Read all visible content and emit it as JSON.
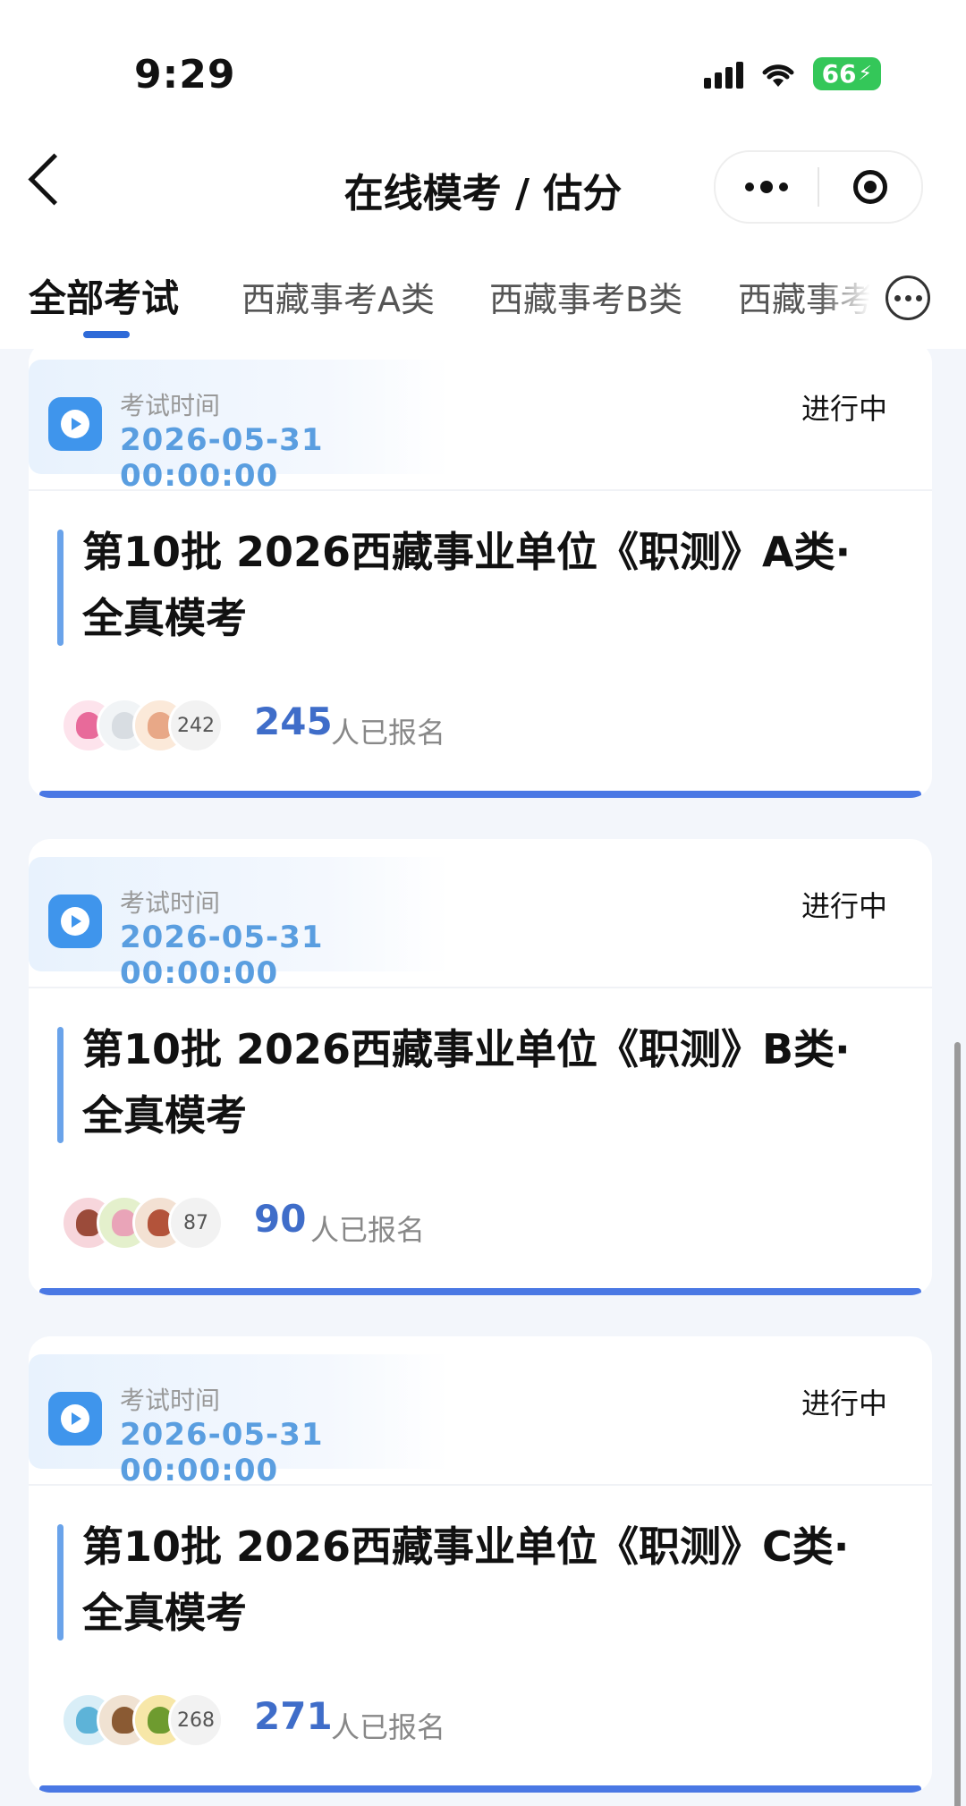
{
  "status_bar": {
    "time": "9:29",
    "battery": "66"
  },
  "nav": {
    "title": "在线模考 / 估分"
  },
  "tabs": [
    {
      "label": "全部考试",
      "active": true
    },
    {
      "label": "西藏事考A类",
      "active": false
    },
    {
      "label": "西藏事考B类",
      "active": false
    },
    {
      "label": "西藏事考",
      "active": false
    }
  ],
  "cards": [
    {
      "time_label": "考试时间",
      "time_value": "2026-05-31 00:00:00",
      "status": "进行中",
      "title": "第10批 2026西藏事业单位《职测》A类·全真模考",
      "avatar_count": "242",
      "enrolled": "245",
      "enrolled_suffix": "人已报名"
    },
    {
      "time_label": "考试时间",
      "time_value": "2026-05-31 00:00:00",
      "status": "进行中",
      "title": "第10批 2026西藏事业单位《职测》B类·全真模考",
      "avatar_count": "87",
      "enrolled": "90",
      "enrolled_suffix": "人已报名"
    },
    {
      "time_label": "考试时间",
      "time_value": "2026-05-31 00:00:00",
      "status": "进行中",
      "title": "第10批 2026西藏事业单位《职测》C类·全真模考",
      "avatar_count": "268",
      "enrolled": "271",
      "enrolled_suffix": "人已报名"
    }
  ],
  "colors": {
    "accent": "#2e6ad8",
    "status_green": "#34c759",
    "date_blue": "#5a9ee0",
    "count_blue": "#3f6dc9"
  }
}
